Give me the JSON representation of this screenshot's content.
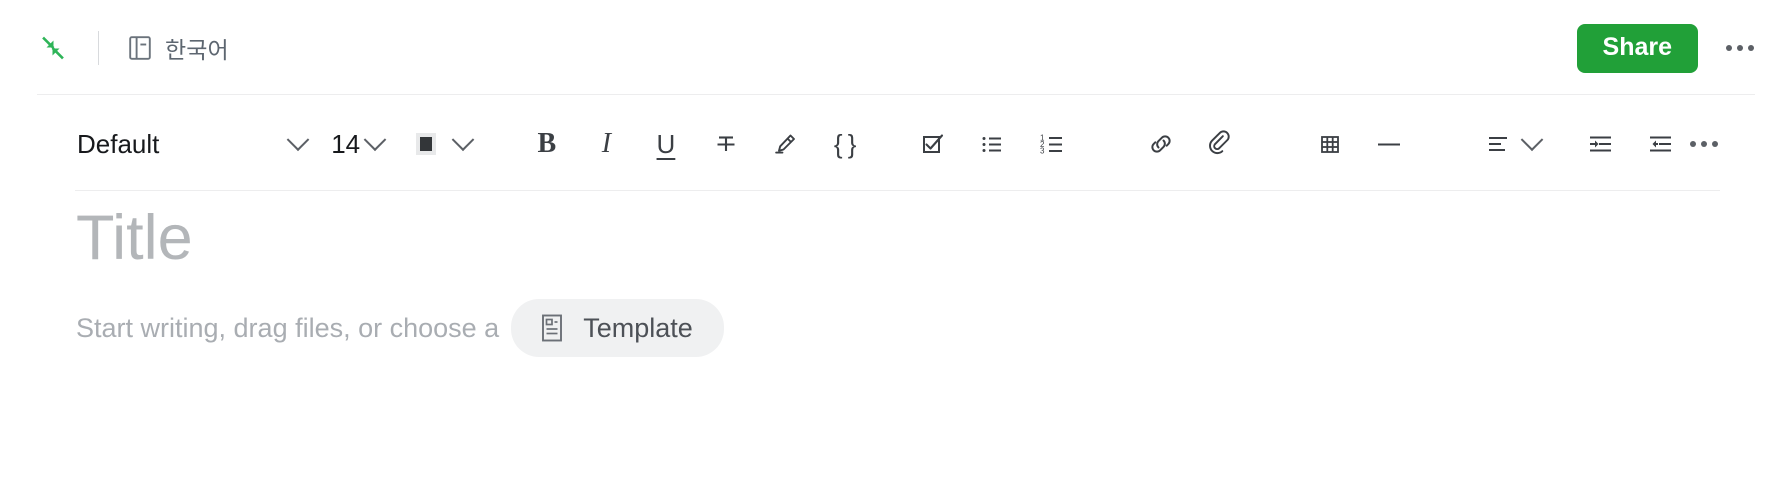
{
  "theme": {
    "accent_green": "#21a038",
    "text_dark": "#17191c",
    "icon_gray": "#414549",
    "placeholder_gray": "#a9adb2",
    "title_gray": "#b3b6b9",
    "divider": "#ededee",
    "pill_bg": "#f0f1f2",
    "swatch_color": "#333639"
  },
  "header": {
    "collapse_icon": "collapse-arrows-icon",
    "notebook_icon": "notebook-icon",
    "notebook_label": "한국어",
    "share_label": "Share",
    "more_icon": "more-horizontal-icon"
  },
  "toolbar": {
    "font_family": "Default",
    "font_family_caret": "chevron-down-icon",
    "font_size": "14",
    "font_size_caret": "chevron-down-icon",
    "text_color_swatch": "#333639",
    "text_color_caret": "chevron-down-icon",
    "buttons": [
      {
        "name": "bold-button",
        "icon": "bold-icon",
        "label": "B"
      },
      {
        "name": "italic-button",
        "icon": "italic-icon",
        "label": "I"
      },
      {
        "name": "underline-button",
        "icon": "underline-icon",
        "label": "U"
      },
      {
        "name": "strikethrough-button",
        "icon": "strikethrough-icon",
        "label": ""
      },
      {
        "name": "highlight-button",
        "icon": "highlighter-icon",
        "label": ""
      },
      {
        "name": "code-button",
        "icon": "code-braces-icon",
        "label": "{ }"
      },
      {
        "name": "checklist-button",
        "icon": "checkbox-list-icon",
        "label": ""
      },
      {
        "name": "bulleted-list-button",
        "icon": "bulleted-list-icon",
        "label": ""
      },
      {
        "name": "numbered-list-button",
        "icon": "numbered-list-icon",
        "label": ""
      },
      {
        "name": "link-button",
        "icon": "link-icon",
        "label": ""
      },
      {
        "name": "attachment-button",
        "icon": "paperclip-icon",
        "label": ""
      },
      {
        "name": "table-button",
        "icon": "table-grid-icon",
        "label": ""
      },
      {
        "name": "horizontal-rule-button",
        "icon": "horizontal-rule-icon",
        "label": ""
      },
      {
        "name": "align-button",
        "icon": "align-left-icon",
        "label": ""
      },
      {
        "name": "align-caret",
        "icon": "chevron-down-icon",
        "label": ""
      },
      {
        "name": "indent-button",
        "icon": "indent-increase-icon",
        "label": ""
      },
      {
        "name": "outdent-button",
        "icon": "indent-decrease-icon",
        "label": ""
      },
      {
        "name": "more-options-button",
        "icon": "more-horizontal-icon",
        "label": ""
      }
    ],
    "numbered_list_digits": [
      "1",
      "2",
      "3"
    ]
  },
  "editor": {
    "title_placeholder": "Title",
    "body_placeholder": "Start writing, drag files, or choose a",
    "template_label": "Template",
    "template_icon": "template-document-icon"
  }
}
